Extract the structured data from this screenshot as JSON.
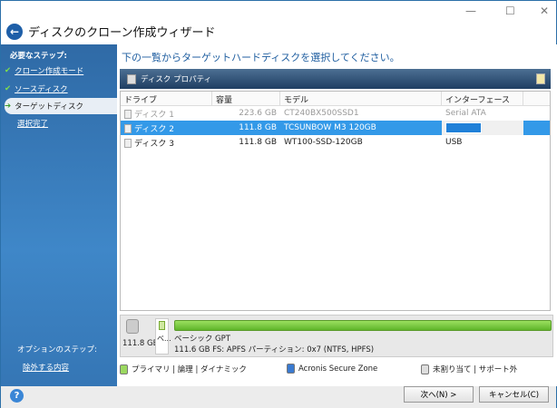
{
  "window": {
    "title": "ディスクのクローン作成ウィザード",
    "minimize": "—",
    "maximize": "☐",
    "close": "✕"
  },
  "sidebar": {
    "required_label": "必要なステップ:",
    "steps": [
      {
        "label": "クローン作成モード",
        "state": "done"
      },
      {
        "label": "ソースディスク",
        "state": "done"
      },
      {
        "label": "ターゲットディスク",
        "state": "current"
      },
      {
        "label": "選択完了",
        "state": "pending"
      }
    ],
    "optional_label": "オプションのステップ:",
    "optional_steps": [
      {
        "label": "除外する内容"
      }
    ]
  },
  "main": {
    "heading": "下の一覧からターゲットハードディスクを選択してください。",
    "toolbar": {
      "label": "ディスク プロパティ"
    },
    "columns": [
      "ドライブ",
      "容量",
      "モデル",
      "インターフェース"
    ],
    "rows": [
      {
        "drive": "ディスク 1",
        "size": "223.6 GB",
        "model": "CT240BX500SSD1",
        "iface": "Serial ATA",
        "state": "disabled"
      },
      {
        "drive": "ディスク 2",
        "size": "111.8 GB",
        "model": "TCSUNBOW M3 120GB",
        "iface": "",
        "state": "selected"
      },
      {
        "drive": "ディスク 3",
        "size": "111.8 GB",
        "model": "WT100-SSD-120GB",
        "iface": "USB",
        "state": "normal"
      }
    ],
    "panel": {
      "disk_size": "111.8 GB",
      "slot_label": "ベ...",
      "partition_type": "ベーシック GPT",
      "partition_info": "111.6 GB  FS: APFS パーティション: 0x7 (NTFS, HPFS)",
      "used_fraction": 1.0
    },
    "legend": {
      "primary": "プライマリ | 論理 | ダイナミック",
      "asz": "Acronis Secure Zone",
      "unalloc": "未割り当て | サポート外"
    }
  },
  "footer": {
    "help": "?",
    "next": "次へ(N) >",
    "cancel": "キャンセル(C)"
  }
}
